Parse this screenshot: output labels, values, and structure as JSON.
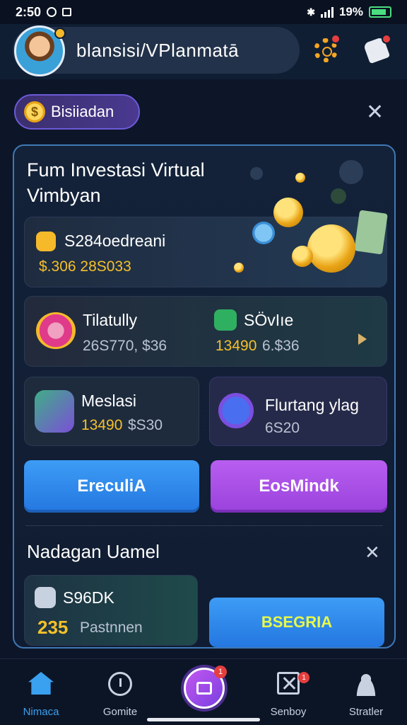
{
  "status_bar": {
    "time": "2:50",
    "battery": "19%"
  },
  "header": {
    "profile_name": "blansisi/VPlanmatā"
  },
  "chip": {
    "label": "Bisiiadan",
    "coin_glyph": "$"
  },
  "panel": {
    "title": "Fum Investasi Virtual Vimbyan",
    "balance_card": {
      "label": "S284oedreani",
      "value": "$.306 28S033"
    },
    "stat_left": {
      "label": "Tilatully",
      "value": "26S770, $36"
    },
    "stat_right": {
      "label": "SÖvIıe",
      "value_yellow": "13490",
      "value_muted": "6.$36"
    },
    "card_a": {
      "label": "Meslasi",
      "value_yellow": "13490",
      "value_muted": "$S30"
    },
    "card_b": {
      "label": "Flurtang ylag",
      "value": "6S20"
    },
    "button_left": "EreculiA",
    "button_right": "EosMindk"
  },
  "section2": {
    "title": "Nadagan Uamel",
    "card": {
      "label": "S96DK",
      "value_yellow": "235",
      "value_muted": "Pastnnen"
    },
    "button": "BSEGRIA"
  },
  "bottom_nav": {
    "items": [
      {
        "label": "Nimaca",
        "icon": "home-icon"
      },
      {
        "label": "Gomite",
        "icon": "clock-icon"
      },
      {
        "label": "",
        "icon": "edit-icon",
        "badge": "1"
      },
      {
        "label": "Senboy",
        "icon": "box-icon",
        "badge": "1"
      },
      {
        "label": "Stratler",
        "icon": "user-icon"
      }
    ]
  },
  "colors": {
    "accent_blue": "#2f86f0",
    "accent_purple": "#a64ae6",
    "yellow": "#f5c12a",
    "panel_border": "#3f78b5"
  }
}
